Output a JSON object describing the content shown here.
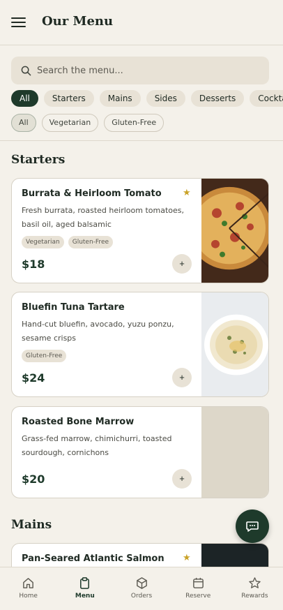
{
  "header": {
    "title": "Our Menu",
    "menu_icon": "hamburger-icon"
  },
  "search": {
    "placeholder": "Search the menu..."
  },
  "categories": [
    "All",
    "Starters",
    "Mains",
    "Sides",
    "Desserts",
    "Cocktails"
  ],
  "active_category": "All",
  "filters": [
    "All",
    "Vegetarian",
    "Gluten-Free"
  ],
  "active_filter": "All",
  "sections": [
    {
      "title": "Starters"
    },
    {
      "title": "Mains"
    }
  ],
  "items": [
    {
      "name": "Burrata & Heirloom Tomato",
      "desc_line1": "Fresh burrata, roasted heirloom tomatoes,",
      "desc_line2": "basil oil, aged balsamic",
      "tags": [
        "Vegetarian",
        "Gluten-Free"
      ],
      "price": "$18",
      "featured": true
    },
    {
      "name": "Bluefin Tuna Tartare",
      "desc_line1": "Hand-cut bluefin, avocado, yuzu ponzu,",
      "desc_line2": "sesame crisps",
      "tags": [
        "Gluten-Free"
      ],
      "price": "$24",
      "featured": false
    },
    {
      "name": "Roasted Bone Marrow",
      "desc_line1": "Grass-fed marrow, chimichurri, toasted",
      "desc_line2": "sourdough, cornichons",
      "tags": [],
      "price": "$20",
      "featured": false
    },
    {
      "name": "Pan-Seared Atlantic Salmon",
      "featured": true
    }
  ],
  "add_label": "+",
  "star_glyph": "★",
  "chat_icon": "chat-icon",
  "bottom_nav": [
    {
      "label": "Home",
      "icon": "home-icon"
    },
    {
      "label": "Menu",
      "icon": "clipboard-icon"
    },
    {
      "label": "Orders",
      "icon": "box-icon"
    },
    {
      "label": "Reserve",
      "icon": "calendar-icon"
    },
    {
      "label": "Rewards",
      "icon": "star-icon"
    }
  ],
  "active_nav": "Menu",
  "colors": {
    "accent": "#1e3a2b",
    "background": "#f4f1ea",
    "chip": "#e8e2d6",
    "star": "#c9a227"
  }
}
